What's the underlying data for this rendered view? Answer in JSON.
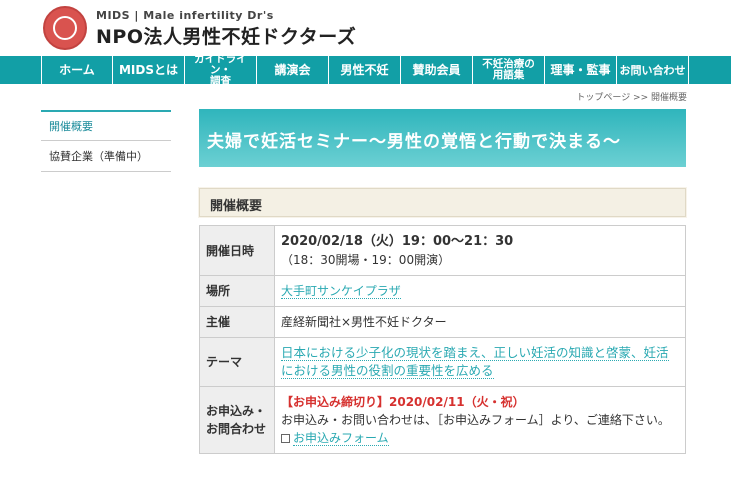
{
  "header": {
    "sub_title": "MIDS | Male infertility Dr's",
    "main_title": "NPO法人男性不妊ドクターズ"
  },
  "nav": {
    "items": [
      {
        "label": "ホーム"
      },
      {
        "label": "MIDSとは"
      },
      {
        "label": "ガイドライン・\n調査"
      },
      {
        "label": "講演会"
      },
      {
        "label": "男性不妊"
      },
      {
        "label": "賛助会員"
      },
      {
        "label": "不妊治療の\n用語集"
      },
      {
        "label": "理事・監事"
      },
      {
        "label": "お問い合わせ"
      }
    ]
  },
  "breadcrumb": "トップページ >>  開催概要",
  "sidebar": {
    "items": [
      {
        "label": "開催概要"
      },
      {
        "label": "協賛企業（準備中）"
      }
    ]
  },
  "banner": {
    "title": "夫婦で妊活セミナー～男性の覚悟と行動で決まる～"
  },
  "section": {
    "title": "開催概要"
  },
  "table": {
    "rows": [
      {
        "label": "開催日時",
        "date": "2020/02/18（火）19：00～21：30",
        "note": "（18：30開場・19：00開演）"
      },
      {
        "label": "場所",
        "value": "大手町サンケイプラザ"
      },
      {
        "label": "主催",
        "value": "産経新聞社×男性不妊ドクター"
      },
      {
        "label": "テーマ",
        "value": "日本における少子化の現状を踏まえ、正しい妊活の知識と啓蒙、妊活における男性の役割の重要性を広める"
      },
      {
        "label": "お申込み・お問合わせ",
        "deadline": "【お申込み締切り】2020/02/11（火・祝）",
        "text": "お申込み・お問い合わせは、［お申込みフォーム］より、ご連絡下さい。",
        "link": "お申込みフォーム"
      }
    ]
  }
}
